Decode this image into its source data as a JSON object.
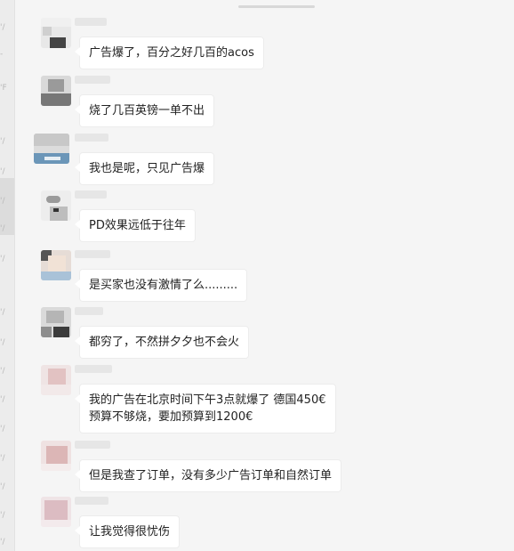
{
  "messages": [
    {
      "text_lines": [
        "广告爆了，百分之好几百的acos"
      ]
    },
    {
      "text_lines": [
        "烧了几百英镑一单不出"
      ]
    },
    {
      "text_lines": [
        "我也是呢，只见广告爆"
      ]
    },
    {
      "text_lines": [
        "PD效果远低于往年"
      ]
    },
    {
      "text_lines": [
        "是买家也没有激情了么........."
      ]
    },
    {
      "text_lines": [
        "都穷了，不然拼夕夕也不会火"
      ]
    },
    {
      "text_lines": [
        "我的广告在北京时间下午3点就爆了  德国450€",
        "预算不够烧，要加预算到1200€"
      ]
    },
    {
      "text_lines": [
        "但是我查了订单，没有多少广告订单和自然订单"
      ]
    },
    {
      "text_lines": [
        "让我觉得很忧伤"
      ]
    }
  ],
  "colors": {
    "background": "#f5f5f5",
    "bubble": "#ffffff",
    "text": "#222222"
  }
}
